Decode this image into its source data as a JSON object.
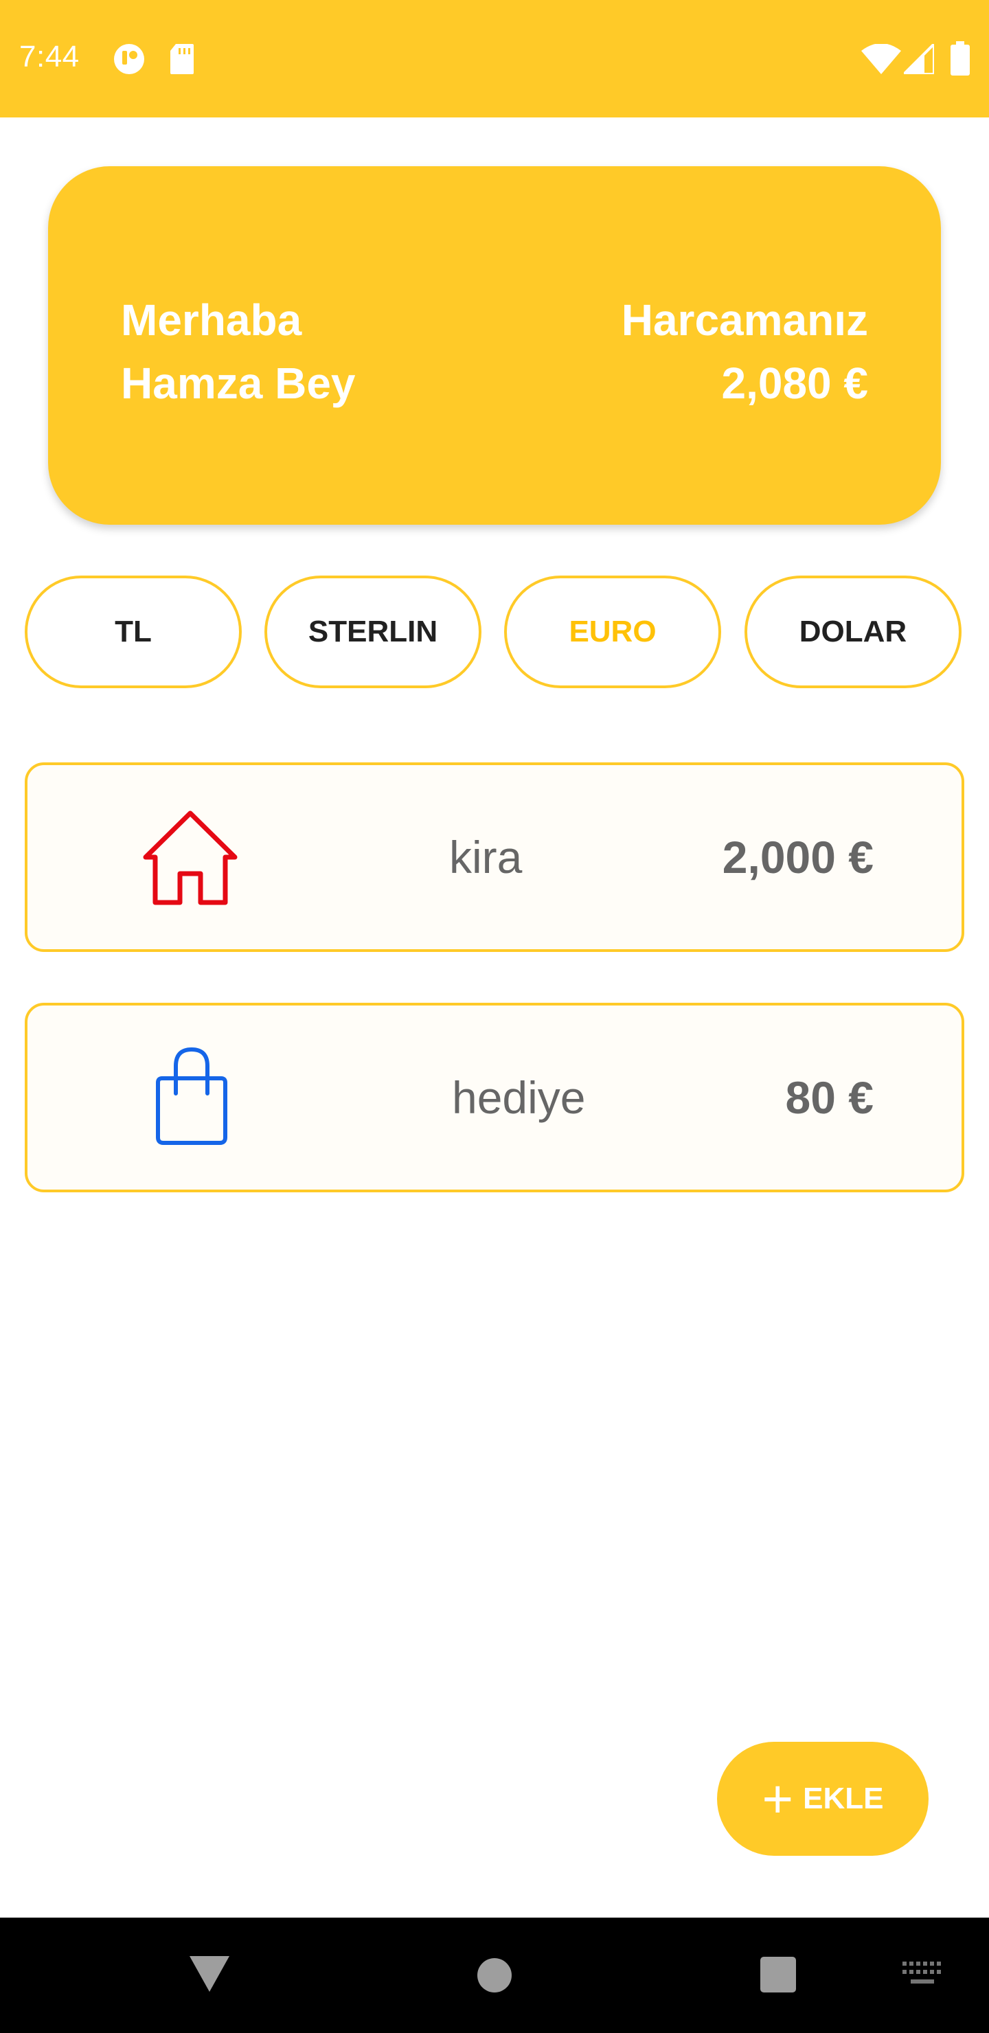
{
  "status_bar": {
    "time": "7:44",
    "color": "#FFCA28"
  },
  "summary": {
    "greeting_line1": "Merhaba",
    "greeting_line2": "Hamza Bey",
    "spend_label": "Harcamanız",
    "spend_total": "2,080 €"
  },
  "currencies": [
    {
      "label": "TL",
      "active": false
    },
    {
      "label": "STERLIN",
      "active": false
    },
    {
      "label": "EURO",
      "active": true
    },
    {
      "label": "DOLAR",
      "active": false
    }
  ],
  "expenses": [
    {
      "name": "kira",
      "amount": "2,000 €",
      "icon": "house-icon",
      "icon_color": "#E50914"
    },
    {
      "name": "hediye",
      "amount": "80 €",
      "icon": "shopping-bag-icon",
      "icon_color": "#1565E8"
    }
  ],
  "fab": {
    "label": "EKLE",
    "icon": "plus-icon"
  },
  "colors": {
    "accent": "#FFCA28",
    "active_text": "#FFC107"
  }
}
